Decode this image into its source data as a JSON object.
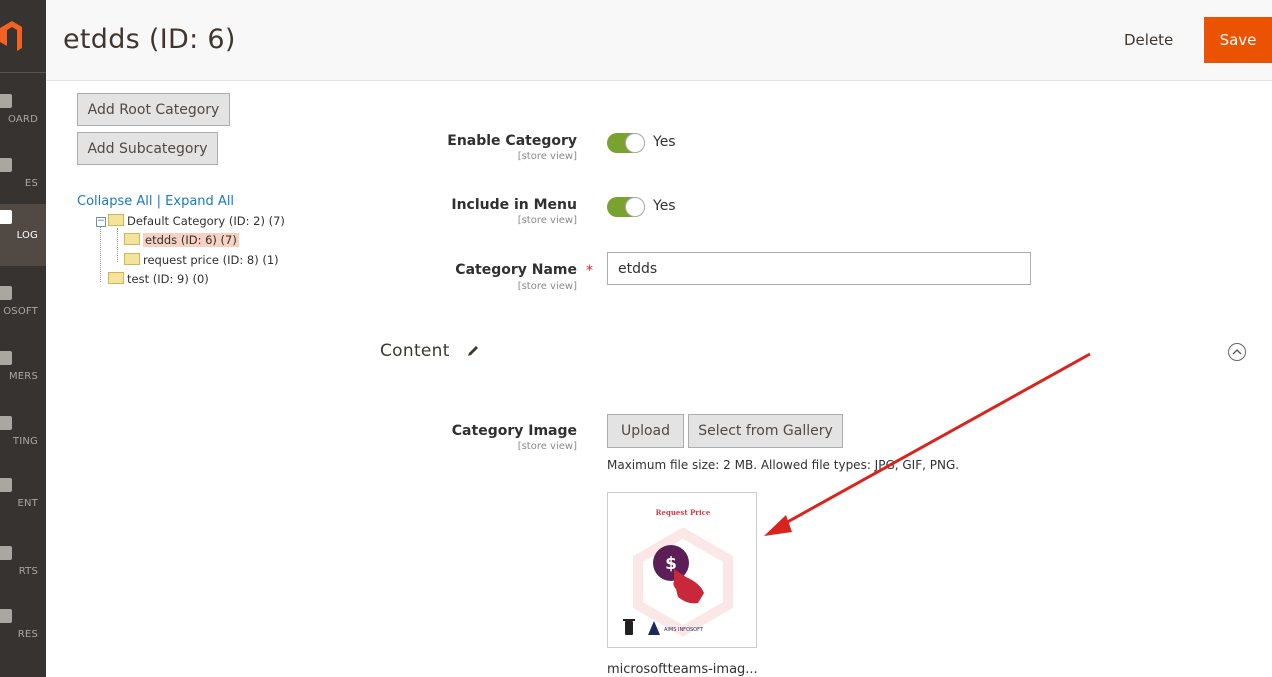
{
  "sidebar": {
    "items": [
      {
        "label": "OARD",
        "active": false
      },
      {
        "label": "ES",
        "active": false
      },
      {
        "label": "LOG",
        "active": true
      },
      {
        "label": "OSOFT",
        "active": false
      },
      {
        "label": "MERS",
        "active": false
      },
      {
        "label": "TING",
        "active": false
      },
      {
        "label": "ENT",
        "active": false
      },
      {
        "label": "RTS",
        "active": false
      },
      {
        "label": "RES",
        "active": false
      }
    ]
  },
  "header": {
    "title": "etdds (ID: 6)",
    "delete_label": "Delete",
    "save_label": "Save"
  },
  "tree": {
    "add_root_label": "Add Root Category",
    "add_sub_label": "Add Subcategory",
    "collapse_all": "Collapse All",
    "separator": "|",
    "expand_all": "Expand All",
    "nodes": [
      {
        "label": "Default Category (ID: 2) (7)"
      },
      {
        "label": "etdds (ID: 6) (7)",
        "selected": true
      },
      {
        "label": "request price (ID: 8) (1)"
      },
      {
        "label": "test (ID: 9) (0)"
      }
    ]
  },
  "form": {
    "enable_category": {
      "label": "Enable Category",
      "scope": "[store view]",
      "value": "Yes"
    },
    "include_in_menu": {
      "label": "Include in Menu",
      "scope": "[store view]",
      "value": "Yes"
    },
    "category_name": {
      "label": "Category Name",
      "scope": "[store view]",
      "value": "etdds",
      "required_mark": "*"
    }
  },
  "content": {
    "title": "Content",
    "category_image": {
      "label": "Category Image",
      "scope": "[store view]",
      "upload_label": "Upload",
      "gallery_label": "Select from Gallery",
      "hint": "Maximum file size: 2 MB. Allowed file types: JPG, GIF, PNG.",
      "preview_title": "Request Price",
      "brand_text": "AIMS INFOSOFT",
      "filename": "microsoftteams-imag..."
    }
  },
  "colors": {
    "accent": "#eb5202",
    "toggle_on": "#79a22e",
    "sidebar": "#373330",
    "annotation_arrow": "#d9231d"
  }
}
